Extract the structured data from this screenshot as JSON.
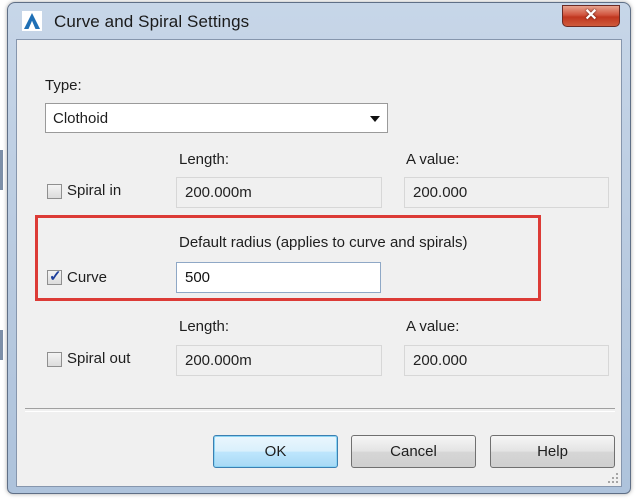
{
  "window": {
    "title": "Curve and Spiral Settings",
    "close_label": "✕"
  },
  "type": {
    "label": "Type:",
    "selected": "Clothoid"
  },
  "spiral_in": {
    "checkbox_label": "Spiral in",
    "checked": false,
    "length_header": "Length:",
    "length_value": "200.000m",
    "a_value_header": "A value:",
    "a_value": "200.000"
  },
  "curve": {
    "checkbox_label": "Curve",
    "checked": true,
    "radius_header": "Default radius (applies to curve and spirals)",
    "radius_value": "500"
  },
  "spiral_out": {
    "checkbox_label": "Spiral out",
    "checked": false,
    "length_header": "Length:",
    "length_value": "200.000m",
    "a_value_header": "A value:",
    "a_value": "200.000"
  },
  "buttons": {
    "ok": "OK",
    "cancel": "Cancel",
    "help": "Help"
  },
  "colors": {
    "highlight_border": "#dc3b36",
    "close_button": "#c0361f",
    "titlebar": "#b7c9df"
  },
  "icons": {
    "app": "autocad-logo-icon",
    "close": "close-icon",
    "dropdown": "chevron-down-icon",
    "grip": "resize-grip-icon"
  }
}
